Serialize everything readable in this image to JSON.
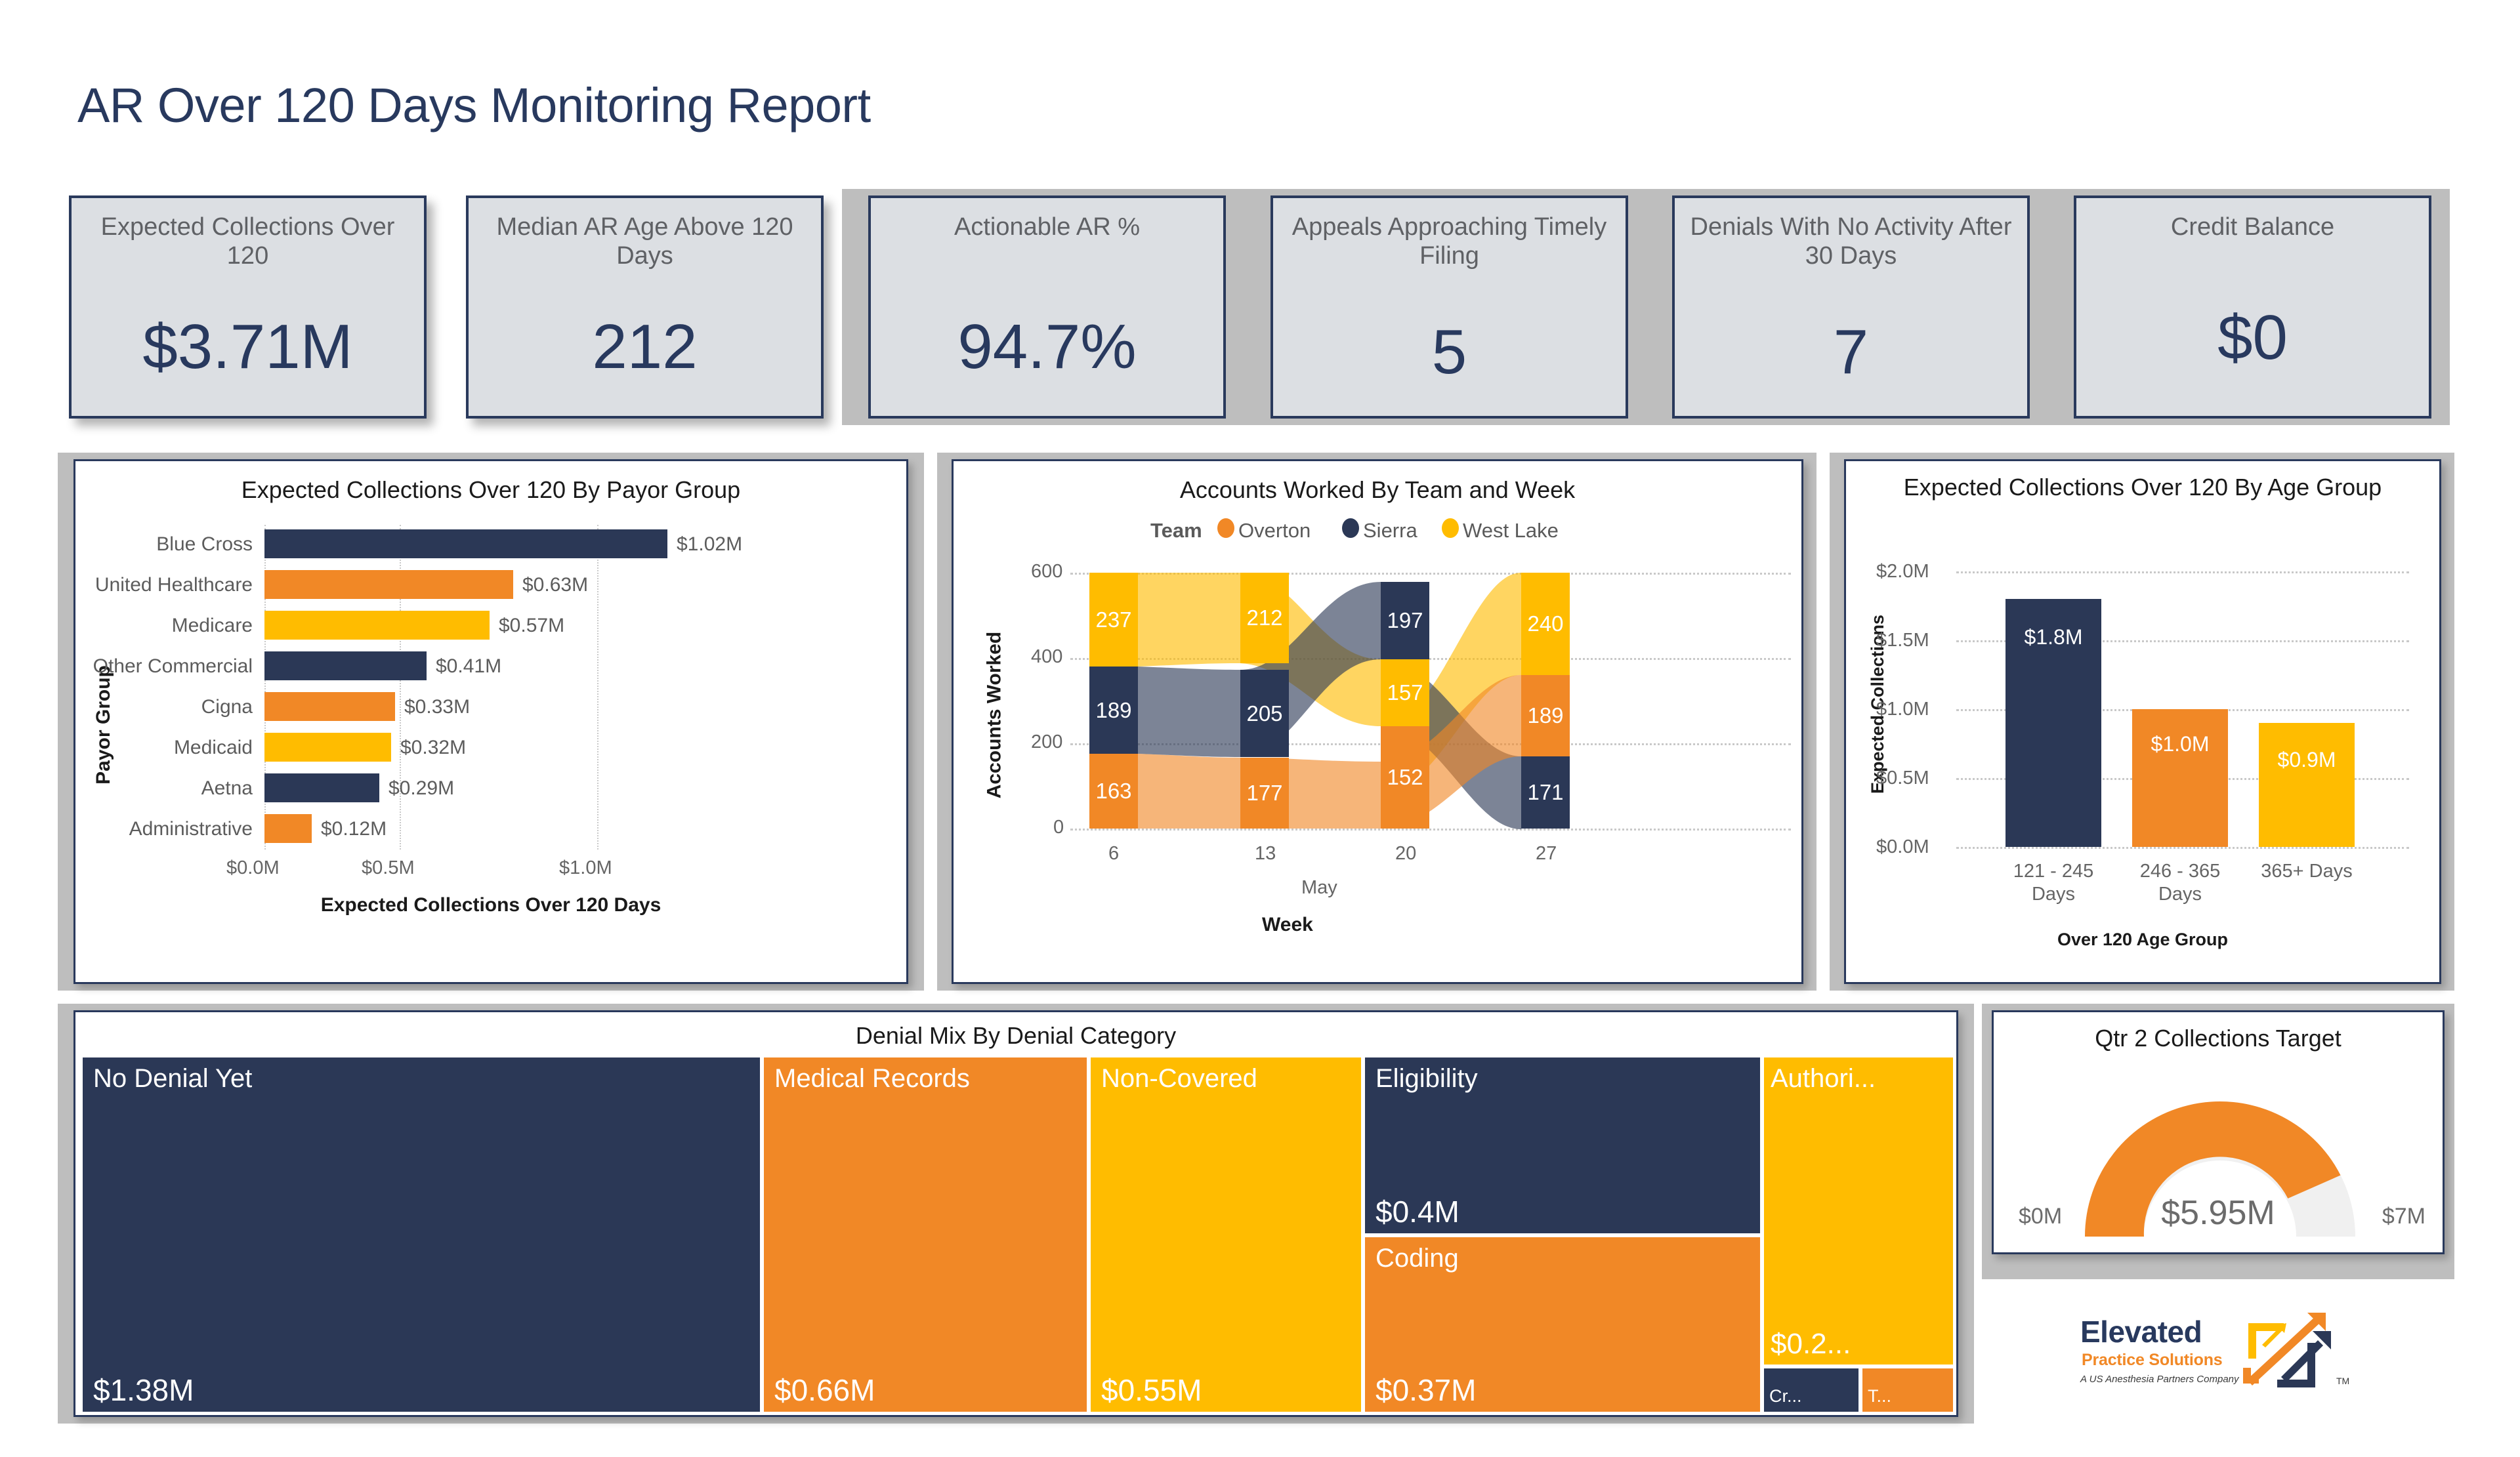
{
  "page": {
    "title": "AR Over 120 Days Monitoring Report",
    "colors": {
      "navy": "#2B3856",
      "orange": "#F18826",
      "yellow": "#FFBC00",
      "card_fill": "#DCDFE3",
      "card_border": "#29395C",
      "panel_gray": "#BEBEBE",
      "gauge_track": "#F0F0F0"
    }
  },
  "kpis": [
    {
      "label": "Expected Collections Over 120",
      "value": "$3.71M"
    },
    {
      "label": "Median AR Age Above 120 Days",
      "value": "212"
    },
    {
      "label": "Actionable AR %",
      "value": "94.7%"
    },
    {
      "label": "Appeals Approaching Timely Filing",
      "value": "5"
    },
    {
      "label": "Denials With No Activity After 30 Days",
      "value": "7"
    },
    {
      "label": "Credit Balance",
      "value": "$0"
    }
  ],
  "chart_data": [
    {
      "id": "payor_bar",
      "type": "bar",
      "orientation": "horizontal",
      "title": "Expected Collections Over 120 By Payor Group",
      "ylabel": "Payor Group",
      "xlabel": "Expected Collections Over 120 Days",
      "categories": [
        "Blue Cross",
        "United Healthcare",
        "Medicare",
        "Other Commercial",
        "Cigna",
        "Medicaid",
        "Aetna",
        "Administrative"
      ],
      "values": [
        1.02,
        0.63,
        0.57,
        0.41,
        0.33,
        0.32,
        0.29,
        0.12
      ],
      "value_labels": [
        "$1.02M",
        "$0.63M",
        "$0.57M",
        "$0.41M",
        "$0.33M",
        "$0.32M",
        "$0.29M",
        "$0.12M"
      ],
      "bar_colors": [
        "#2B3856",
        "#F18826",
        "#FFBC00",
        "#2B3856",
        "#F18826",
        "#FFBC00",
        "#2B3856",
        "#F18826"
      ],
      "xticks": [
        "$0.0M",
        "$0.5M",
        "$1.0M"
      ],
      "xlim": [
        0,
        1.1
      ],
      "grid": true
    },
    {
      "id": "accounts_ribbon",
      "type": "area",
      "title": "Accounts Worked By Team and Week",
      "legend_title": "Team",
      "legend_position": "top",
      "xlabel": "Week",
      "ylabel": "Accounts Worked",
      "x_group_label": "May",
      "x": [
        "6",
        "13",
        "20",
        "27"
      ],
      "yticks": [
        "0",
        "200",
        "400",
        "600"
      ],
      "ylim": [
        0,
        620
      ],
      "series": [
        {
          "name": "Overton",
          "color": "#F18826",
          "values": [
            163,
            177,
            152,
            189
          ]
        },
        {
          "name": "Sierra",
          "color": "#2B3856",
          "values": [
            189,
            205,
            197,
            171
          ]
        },
        {
          "name": "West Lake",
          "color": "#FFBC00",
          "values": [
            237,
            212,
            157,
            240
          ]
        }
      ],
      "stack_order": [
        [
          "West Lake",
          "Sierra",
          "Overton"
        ],
        [
          "West Lake",
          "Sierra",
          "Overton"
        ],
        [
          "Sierra",
          "West Lake",
          "Overton"
        ],
        [
          "West Lake",
          "Overton",
          "Sierra"
        ]
      ]
    },
    {
      "id": "age_group_bar",
      "type": "bar",
      "orientation": "vertical",
      "title": "Expected Collections Over 120 By Age Group",
      "ylabel": "Expected Collections",
      "xlabel": "Over 120 Age Group",
      "categories": [
        "121 - 245 Days",
        "246 - 365 Days",
        "365+ Days"
      ],
      "values": [
        1.8,
        1.0,
        0.9
      ],
      "value_labels": [
        "$1.8M",
        "$1.0M",
        "$0.9M"
      ],
      "bar_colors": [
        "#2B3856",
        "#F18826",
        "#FFBC00"
      ],
      "yticks": [
        "$0.0M",
        "$0.5M",
        "$1.0M",
        "$1.5M",
        "$2.0M"
      ],
      "ylim": [
        0,
        2.0
      ],
      "grid": true
    },
    {
      "id": "denial_treemap",
      "type": "treemap",
      "title": "Denial Mix By Denial Category",
      "nodes": [
        {
          "name": "No Denial Yet",
          "value_label": "$1.38M",
          "value": 1.38,
          "color": "#2B3856"
        },
        {
          "name": "Medical Records",
          "value_label": "$0.66M",
          "value": 0.66,
          "color": "#F18826"
        },
        {
          "name": "Non-Covered",
          "value_label": "$0.55M",
          "value": 0.55,
          "color": "#FFBC00"
        },
        {
          "name": "Eligibility",
          "value_label": "$0.4M",
          "value": 0.4,
          "color": "#2B3856"
        },
        {
          "name": "Coding",
          "value_label": "$0.37M",
          "value": 0.37,
          "color": "#F18826"
        },
        {
          "name": "Authori...",
          "value_label": "$0.2...",
          "value": 0.2,
          "color": "#FFBC00"
        },
        {
          "name": "Cr...",
          "value_label": "",
          "value": 0.05,
          "color": "#2B3856"
        },
        {
          "name": "T...",
          "value_label": "",
          "value": 0.04,
          "color": "#F18826"
        }
      ]
    },
    {
      "id": "qtr2_gauge",
      "type": "pie",
      "subtype": "gauge",
      "title": "Qtr 2 Collections Target",
      "value": 5.95,
      "value_label": "$5.95M",
      "min_label": "$0M",
      "max_label": "$7M",
      "min": 0,
      "max": 7,
      "fill_color": "#F18826",
      "track_color": "#F0F0F0"
    }
  ],
  "logo": {
    "word": "Elevated",
    "sub": "Practice Solutions",
    "tagline": "A US Anesthesia Partners Company",
    "tm": "TM"
  }
}
